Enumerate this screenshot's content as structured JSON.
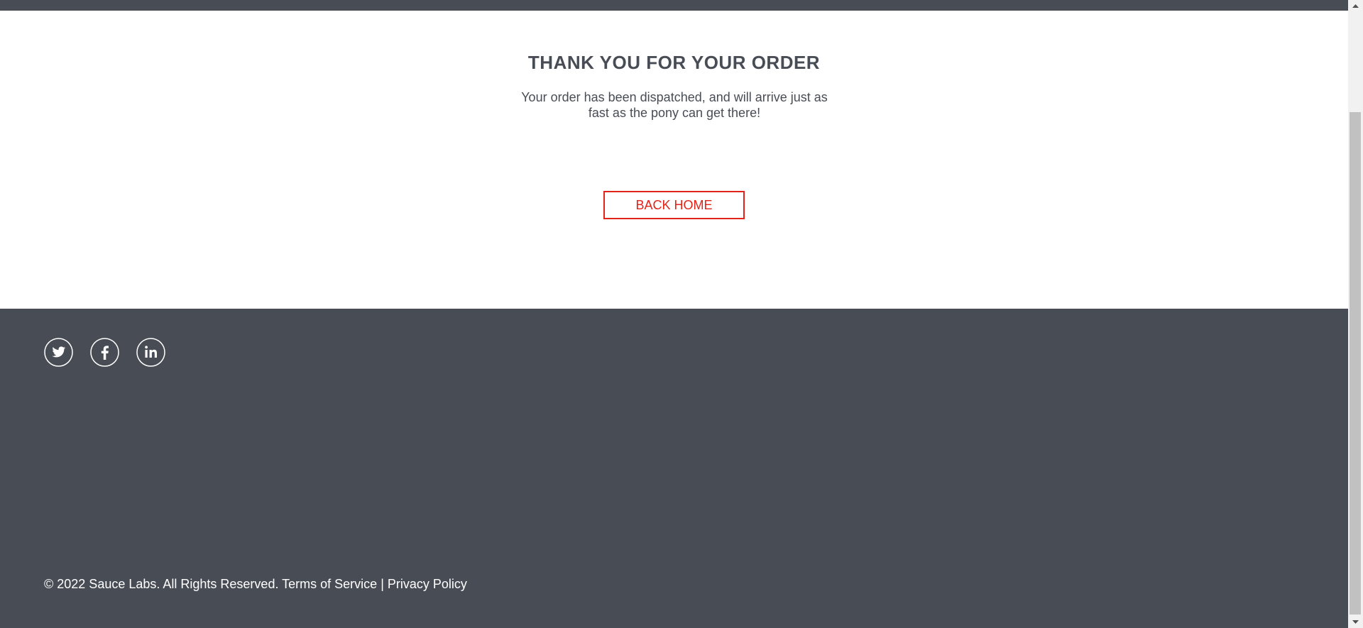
{
  "header": {
    "title": "THANK YOU FOR YOUR ORDER",
    "message": "Your order has been dispatched, and will arrive just as fast as the pony can get there!"
  },
  "actions": {
    "back_home_label": "BACK HOME"
  },
  "footer": {
    "social": [
      "twitter-icon",
      "facebook-icon",
      "linkedin-icon"
    ],
    "copyright": "© 2022 Sauce Labs. All Rights Reserved.",
    "terms_label": "Terms of Service",
    "separator": "|",
    "privacy_label": "Privacy Policy"
  },
  "colors": {
    "dark": "#484c55",
    "accent": "#e2231a",
    "white": "#ffffff"
  }
}
